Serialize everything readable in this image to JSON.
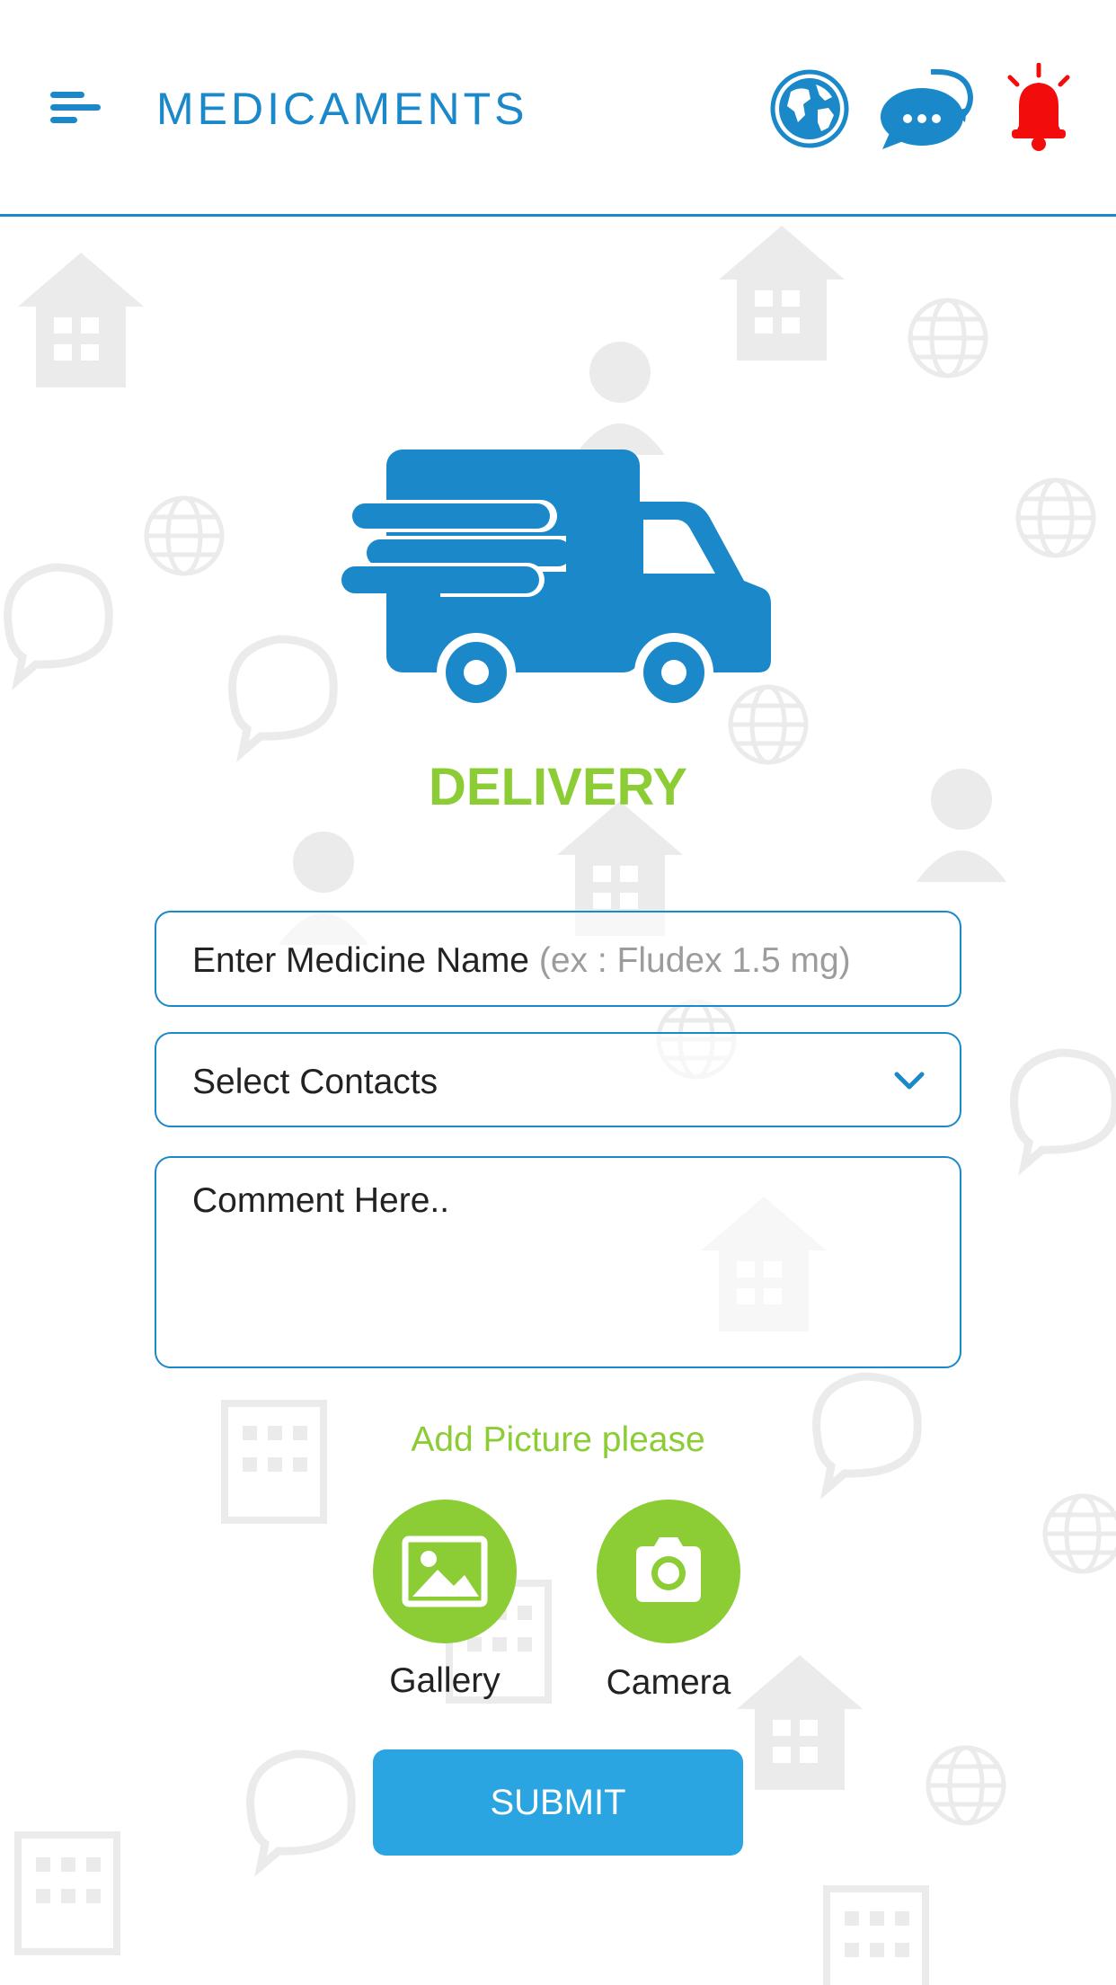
{
  "header": {
    "title": "MEDICAMENTS",
    "icons": [
      "menu-icon",
      "globe-icon",
      "chat-icon",
      "notification-bell-icon"
    ]
  },
  "main": {
    "hero_icon": "delivery-truck-icon",
    "title": "DELIVERY",
    "medicine_field": {
      "label": "Enter Medicine Name",
      "placeholder": "(ex : Fludex 1.5 mg)"
    },
    "contacts_select": {
      "value": "Select Contacts",
      "icon": "chevron-down-icon"
    },
    "comment_field": {
      "placeholder": "Comment Here.."
    },
    "add_picture_label": "Add Picture please",
    "gallery": {
      "label": "Gallery",
      "icon": "image-icon"
    },
    "camera": {
      "label": "Camera",
      "icon": "camera-icon"
    },
    "submit_label": "SUBMIT"
  },
  "colors": {
    "primary_blue": "#1a88c9",
    "submit_blue": "#2ba5e1",
    "accent_green": "#8ccc34",
    "bell_red": "#f20c0c"
  }
}
